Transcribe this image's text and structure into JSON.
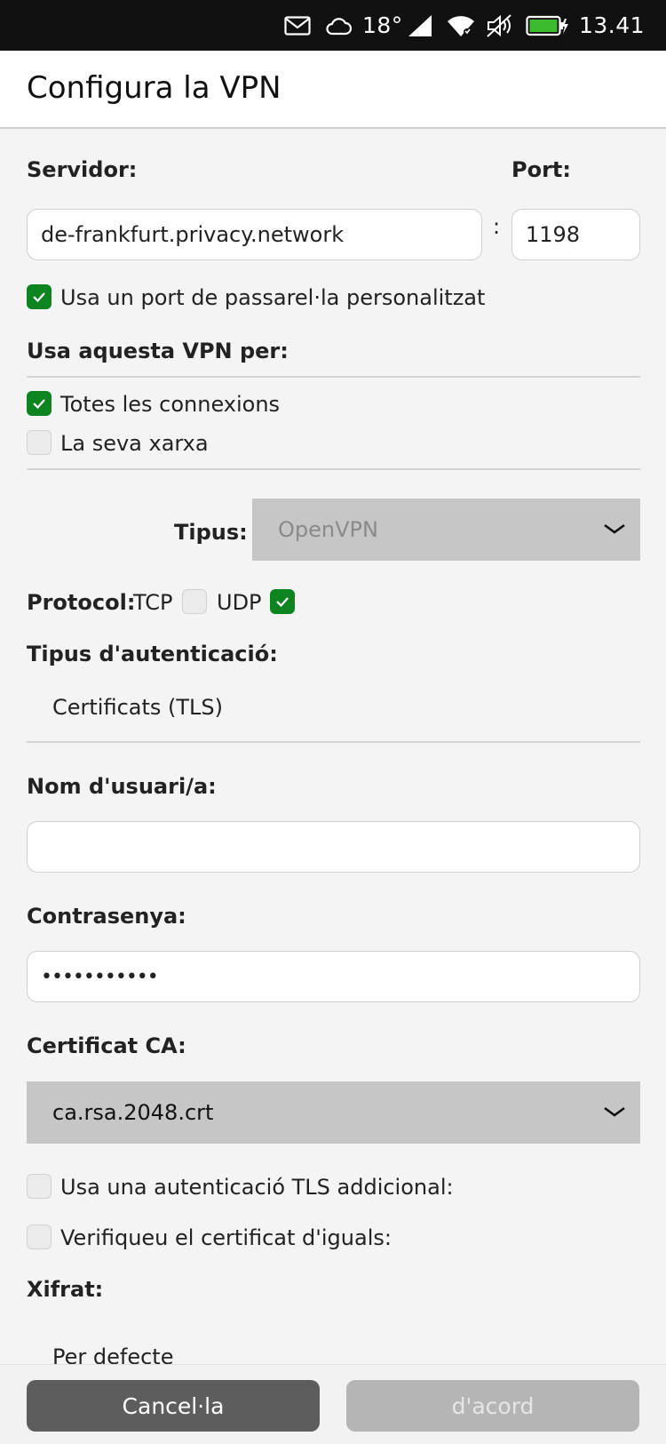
{
  "statusbar": {
    "temperature": "18°",
    "time": "13.41",
    "icons": [
      "mail-icon",
      "cloud-icon",
      "cellular-signal-icon",
      "wifi-icon",
      "muted-speaker-icon",
      "battery-charging-icon"
    ]
  },
  "header": {
    "title": "Configura la VPN"
  },
  "server": {
    "server_label": "Servidor:",
    "port_label": "Port:",
    "server_value": "de-frankfurt.privacy.network",
    "separator": ":",
    "port_value": "1198",
    "custom_gateway_label": "Usa un port de passarel·la personalitzat",
    "custom_gateway_checked": true
  },
  "usage": {
    "title": "Usa aquesta VPN per:",
    "all_connections_label": "Totes les connexions",
    "all_connections_checked": true,
    "own_network_label": "La seva xarxa",
    "own_network_checked": false
  },
  "type": {
    "label": "Tipus:",
    "value": "OpenVPN"
  },
  "protocol": {
    "label": "Protocol:",
    "tcp_label": "TCP",
    "tcp_checked": false,
    "udp_label": "UDP",
    "udp_checked": true
  },
  "auth": {
    "label": "Tipus d'autenticació:",
    "value": "Certificats (TLS)"
  },
  "username": {
    "label": "Nom d'usuari/a:",
    "value": ""
  },
  "password": {
    "label": "Contrasenya:",
    "value": "•••••••••••"
  },
  "ca": {
    "label": "Certificat CA:",
    "value": "ca.rsa.2048.crt"
  },
  "tls_extra": {
    "label": "Usa una autenticació TLS addicional:",
    "checked": false
  },
  "verify_peer": {
    "label": "Verifiqueu el certificat d'iguals:",
    "checked": false
  },
  "cipher": {
    "label": "Xifrat:",
    "value": "Per defecte"
  },
  "footer": {
    "cancel_label": "Cancel·la",
    "ok_label": "d'acord"
  },
  "colors": {
    "accent": "#0e8420",
    "statusbar_bg": "#111111",
    "cancel_bg": "#5d5d5d",
    "ok_bg_disabled": "#b5b5b5",
    "dropdown_bg": "#c6c6c6"
  }
}
